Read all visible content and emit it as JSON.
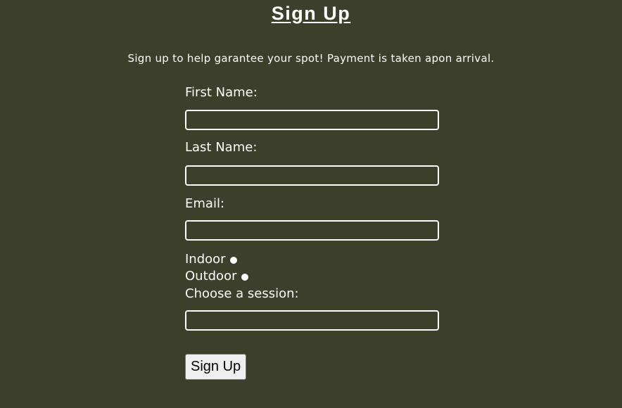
{
  "page": {
    "title": "Sign Up",
    "intro": "Sign up to help garantee your spot! Payment is taken apon arrival."
  },
  "form": {
    "first_name_label": "First Name:",
    "first_name_value": "",
    "last_name_label": "Last Name:",
    "last_name_value": "",
    "email_label": "Email:",
    "email_value": "",
    "indoor_label": "Indoor",
    "outdoor_label": "Outdoor",
    "session_label": "Choose a session:",
    "session_value": "",
    "submit_label": "Sign Up"
  },
  "colors": {
    "background": "#3c3f29",
    "text": "#ffffff",
    "button_bg": "#efefef"
  }
}
